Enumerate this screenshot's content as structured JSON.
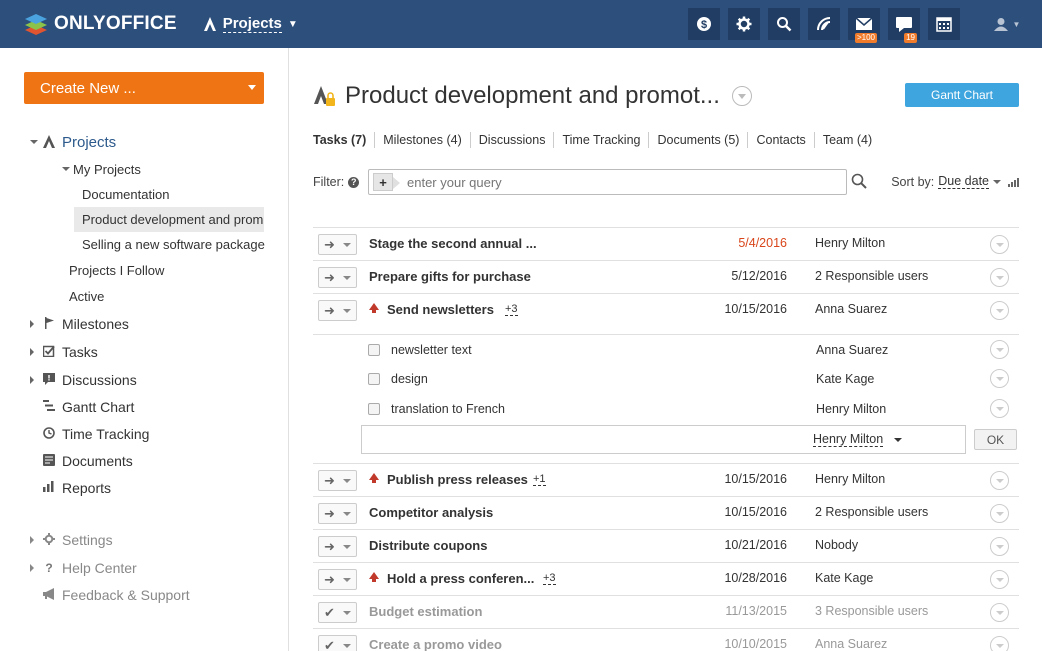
{
  "header": {
    "brand": "ONLYOFFICE",
    "module": "Projects",
    "icons": [
      {
        "name": "payments-icon",
        "glyph": "$"
      },
      {
        "name": "settings-icon",
        "glyph": "✹"
      },
      {
        "name": "search-icon",
        "glyph": "⚲"
      },
      {
        "name": "feed-icon",
        "glyph": "◠"
      },
      {
        "name": "mail-icon",
        "glyph": "✉",
        "badge": ">100"
      },
      {
        "name": "talk-icon",
        "glyph": "▬",
        "badge": "19"
      },
      {
        "name": "calendar-icon",
        "glyph": "▦"
      }
    ],
    "colors": {
      "bar": "#2d4f7c",
      "icon_bg": "#213d63",
      "badge": "#f07b2b"
    }
  },
  "sidebar": {
    "create_label": "Create New ...",
    "projects_label": "Projects",
    "my_projects_label": "My Projects",
    "my_projects": [
      "Documentation",
      "Product development and prom...",
      "Selling a new software package"
    ],
    "projects_i_follow": "Projects I Follow",
    "active": "Active",
    "sections": [
      "Milestones",
      "Tasks",
      "Discussions",
      "Gantt Chart",
      "Time Tracking",
      "Documents",
      "Reports"
    ],
    "footer": [
      "Settings",
      "Help Center",
      "Feedback & Support"
    ],
    "colors": {
      "create": "#ef7414",
      "link": "#2d5a8c"
    }
  },
  "main": {
    "title": "Product development and promot...",
    "gantt_label": "Gantt Chart",
    "tabs": [
      "Tasks (7)",
      "Milestones (4)",
      "Discussions",
      "Time Tracking",
      "Documents (5)",
      "Contacts",
      "Team (4)"
    ],
    "filter_label": "Filter:",
    "filter_placeholder": "enter your query",
    "sort_label": "Sort by:",
    "sort_value": "Due date",
    "tasks": [
      {
        "name": "Stage the second annual ...",
        "date": "5/4/2016",
        "resp": "Henry Milton",
        "overdue": true
      },
      {
        "name": "Prepare gifts for purchase",
        "date": "5/12/2016",
        "resp": "2 Responsible users"
      },
      {
        "name": "Send newsletters",
        "count": "+3",
        "date": "10/15/2016",
        "resp": "Anna Suarez",
        "high": true
      },
      {
        "name": "Publish press releases",
        "count": "+1",
        "date": "10/15/2016",
        "resp": "Henry Milton",
        "high": true
      },
      {
        "name": "Competitor analysis",
        "date": "10/15/2016",
        "resp": "2 Responsible users"
      },
      {
        "name": "Distribute coupons",
        "date": "10/21/2016",
        "resp": "Nobody"
      },
      {
        "name": "Hold a press conferen...",
        "count": "+3",
        "date": "10/28/2016",
        "resp": "Kate Kage",
        "high": true
      },
      {
        "name": "Budget estimation",
        "date": "11/13/2015",
        "resp": "3 Responsible users",
        "done": true
      },
      {
        "name": "Create a promo video",
        "date": "10/10/2015",
        "resp": "Anna Suarez",
        "done": true
      }
    ],
    "subtasks": [
      {
        "name": "newsletter text",
        "resp": "Anna Suarez"
      },
      {
        "name": "design",
        "resp": "Kate Kage"
      },
      {
        "name": "translation to French",
        "resp": "Henry Milton"
      }
    ],
    "new_subtask": {
      "resp": "Henry Milton",
      "ok": "OK"
    },
    "colors": {
      "gantt": "#3ea5de",
      "overdue": "#d9461b",
      "priority": "#c0392b"
    }
  }
}
